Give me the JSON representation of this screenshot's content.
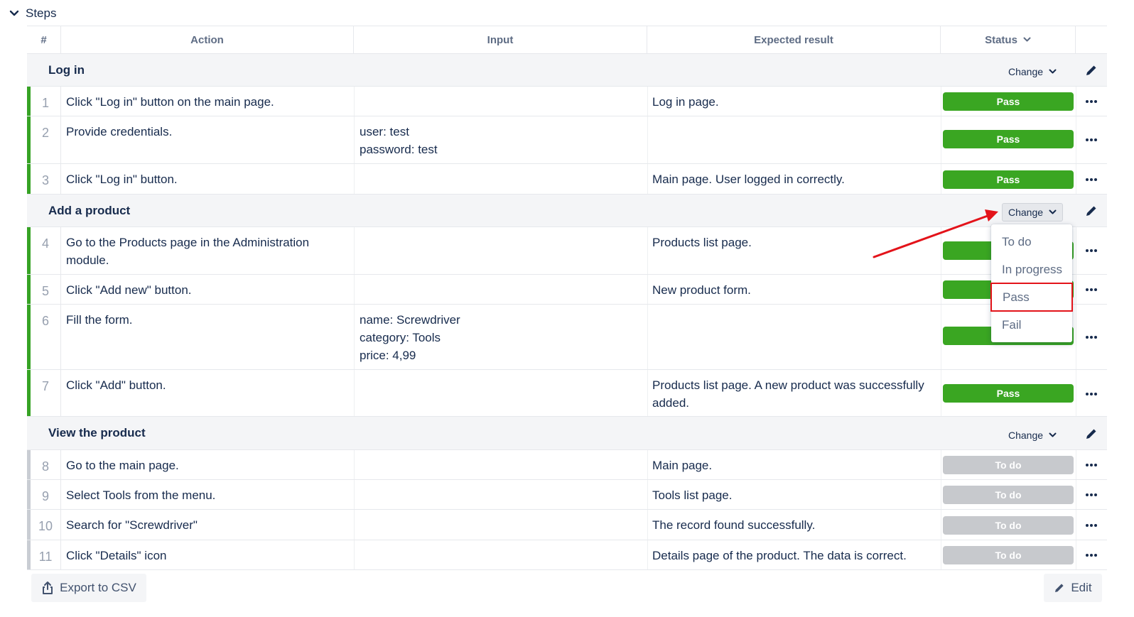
{
  "steps_header": {
    "title": "Steps"
  },
  "columns": {
    "num": "#",
    "action": "Action",
    "input": "Input",
    "expected": "Expected result",
    "status": "Status"
  },
  "sections": [
    {
      "title": "Log in",
      "change_label": "Change"
    },
    {
      "title": "Add a product",
      "change_label": "Change"
    },
    {
      "title": "View the product",
      "change_label": "Change"
    }
  ],
  "rows": [
    {
      "num": "1",
      "action": [
        "Click \"Log in\" button on the main page."
      ],
      "input": [],
      "expected": [
        "Log in page."
      ],
      "status": "Pass"
    },
    {
      "num": "2",
      "action": [
        "Provide credentials."
      ],
      "input": [
        "user: test",
        "password: test"
      ],
      "expected": [],
      "status": "Pass"
    },
    {
      "num": "3",
      "action": [
        "Click \"Log in\" button."
      ],
      "input": [],
      "expected": [
        "Main page. User logged in correctly."
      ],
      "status": "Pass"
    },
    {
      "num": "4",
      "action": [
        "Go to the Products page in the Administration",
        "module."
      ],
      "input": [],
      "expected": [
        "Products list page."
      ],
      "status": ""
    },
    {
      "num": "5",
      "action": [
        "Click \"Add new\" button."
      ],
      "input": [],
      "expected": [
        "New product form."
      ],
      "status": ""
    },
    {
      "num": "6",
      "action": [
        "Fill the form."
      ],
      "input": [
        "name: Screwdriver",
        "category: Tools",
        "price: 4,99"
      ],
      "expected": [],
      "status": ""
    },
    {
      "num": "7",
      "action": [
        "Click \"Add\" button."
      ],
      "input": [],
      "expected": [
        "Products list page. A new product was successfully",
        "added."
      ],
      "status": "Pass"
    },
    {
      "num": "8",
      "action": [
        "Go to the main page."
      ],
      "input": [],
      "expected": [
        "Main page."
      ],
      "status": "To do"
    },
    {
      "num": "9",
      "action": [
        "Select Tools from the menu."
      ],
      "input": [],
      "expected": [
        "Tools list page."
      ],
      "status": "To do"
    },
    {
      "num": "10",
      "action": [
        "Search for \"Screwdriver\""
      ],
      "input": [],
      "expected": [
        "The record found successfully."
      ],
      "status": "To do"
    },
    {
      "num": "11",
      "action": [
        "Click \"Details\" icon"
      ],
      "input": [],
      "expected": [
        "Details page of the product. The data is correct."
      ],
      "status": "To do"
    }
  ],
  "dropdown": {
    "options": [
      "To do",
      "In progress",
      "Pass",
      "Fail"
    ],
    "highlighted": "Pass"
  },
  "footer": {
    "export_label": "Export to CSV",
    "edit_label": "Edit"
  },
  "colors": {
    "pass": "#3aa622",
    "todo": "#c7c9cd",
    "annotation": "#e3131a",
    "progress_bar_done": "#36a324",
    "progress_bar_pending": "#c9cdd3"
  }
}
